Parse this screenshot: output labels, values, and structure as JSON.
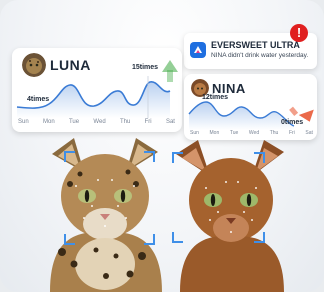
{
  "notification": {
    "app_name": "EVERSWEET ULTRA",
    "message": "NINA didn't drink water yesterday.",
    "alert_symbol": "!"
  },
  "luna": {
    "name": "LUNA",
    "low_label": "4times",
    "high_label": "15times",
    "days": [
      "Sun",
      "Mon",
      "Tue",
      "Wed",
      "Thu",
      "Fri",
      "Sat"
    ],
    "trend": "up"
  },
  "nina": {
    "name": "NINA",
    "high_label": "12times",
    "low_label": "0times",
    "days": [
      "Sun",
      "Mon",
      "Tue",
      "Wed",
      "Thu",
      "Fri",
      "Sat"
    ],
    "trend": "down"
  },
  "colors": {
    "line": "#3a7bd5",
    "up_arrow": "#4caf50",
    "down_arrow": "#e8502a",
    "alert": "#e02020",
    "bracket": "#3f8fe8"
  },
  "icons": [
    "app-logo-icon",
    "alert-icon",
    "trend-up-arrow-icon",
    "trend-down-arrow-icon"
  ]
}
